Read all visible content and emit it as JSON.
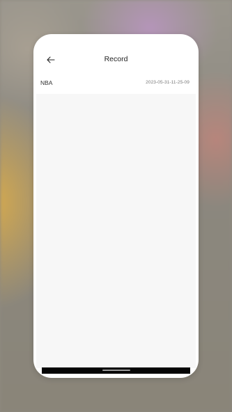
{
  "header": {
    "title": "Record",
    "back_icon": "arrow-left-icon"
  },
  "records": [
    {
      "name": "NBA",
      "date": "2023-05-31-11-25-09"
    }
  ],
  "colors": {
    "surface": "#ffffff",
    "content_bg": "#f7f7f7",
    "nav_bar": "#050505"
  }
}
